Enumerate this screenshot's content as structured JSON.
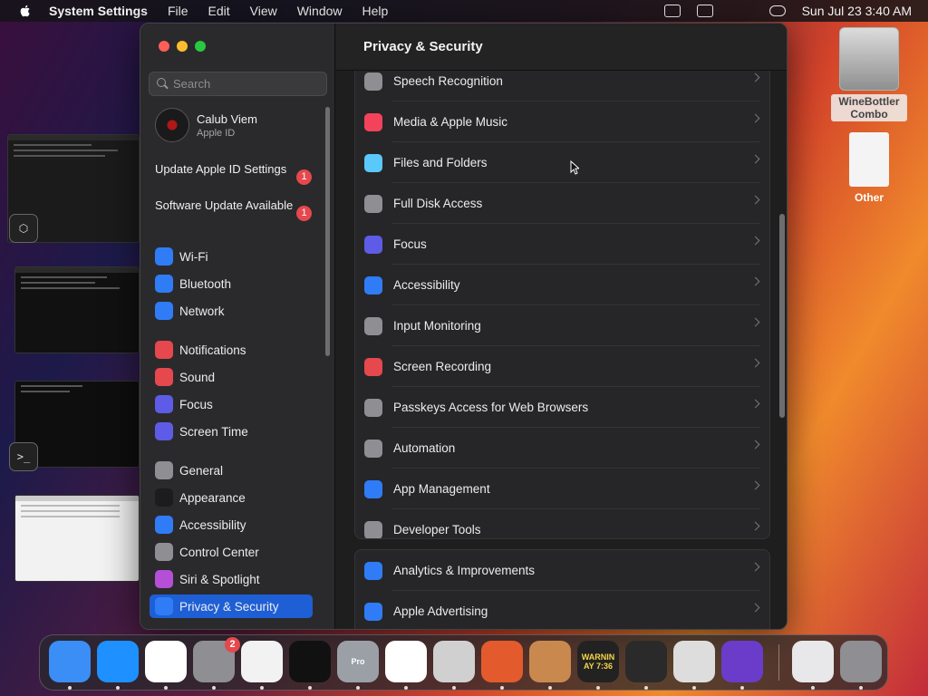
{
  "menubar": {
    "app_name": "System Settings",
    "menus": [
      "File",
      "Edit",
      "View",
      "Window",
      "Help"
    ],
    "datetime": "Sun Jul 23  3:40 AM"
  },
  "desktop": {
    "items": [
      {
        "label": "WineBottler Combo",
        "icon": "disk-image-icon"
      },
      {
        "label": "Other",
        "icon": "log-document-icon"
      }
    ]
  },
  "window": {
    "sidebar": {
      "search_placeholder": "Search",
      "profile": {
        "name": "Calub Viem",
        "subtitle": "Apple ID"
      },
      "alerts": [
        {
          "label": "Update Apple ID Settings",
          "badge": "1"
        },
        {
          "label": "Software Update Available",
          "badge": "1"
        }
      ],
      "items": [
        {
          "label": "Wi-Fi",
          "icon": "wifi-icon",
          "color": "#2f7cf6"
        },
        {
          "label": "Bluetooth",
          "icon": "bluetooth-icon",
          "color": "#2f7cf6"
        },
        {
          "label": "Network",
          "icon": "globe-icon",
          "color": "#2f7cf6"
        },
        {
          "label": "Notifications",
          "icon": "bell-icon",
          "color": "#e5484d"
        },
        {
          "label": "Sound",
          "icon": "speaker-icon",
          "color": "#e5484d"
        },
        {
          "label": "Focus",
          "icon": "moon-icon",
          "color": "#5e5ce6"
        },
        {
          "label": "Screen Time",
          "icon": "hourglass-icon",
          "color": "#5e5ce6"
        },
        {
          "label": "General",
          "icon": "gear-icon",
          "color": "#8e8e93"
        },
        {
          "label": "Appearance",
          "icon": "appearance-icon",
          "color": "#1c1c1e"
        },
        {
          "label": "Accessibility",
          "icon": "accessibility-icon",
          "color": "#2f7cf6"
        },
        {
          "label": "Control Center",
          "icon": "control-center-icon",
          "color": "#8e8e93"
        },
        {
          "label": "Siri & Spotlight",
          "icon": "siri-icon",
          "color": "#b44fd6"
        },
        {
          "label": "Privacy & Security",
          "icon": "hand-icon",
          "color": "#2f7cf6",
          "active": true
        }
      ]
    },
    "content": {
      "title": "Privacy & Security",
      "group1": [
        {
          "label": "Speech Recognition",
          "icon": "waveform-icon",
          "color": "#8e8e93"
        },
        {
          "label": "Media & Apple Music",
          "icon": "music-note-icon",
          "color": "#f2435a"
        },
        {
          "label": "Files and Folders",
          "icon": "folder-icon",
          "color": "#5ac8fa"
        },
        {
          "label": "Full Disk Access",
          "icon": "disk-icon",
          "color": "#8e8e93"
        },
        {
          "label": "Focus",
          "icon": "moon-icon",
          "color": "#5e5ce6"
        },
        {
          "label": "Accessibility",
          "icon": "accessibility-icon",
          "color": "#2f7cf6"
        },
        {
          "label": "Input Monitoring",
          "icon": "keyboard-icon",
          "color": "#8e8e93"
        },
        {
          "label": "Screen Recording",
          "icon": "record-icon",
          "color": "#e5484d"
        },
        {
          "label": "Passkeys Access for Web Browsers",
          "icon": "person-key-icon",
          "color": "#8e8e93"
        },
        {
          "label": "Automation",
          "icon": "gears-icon",
          "color": "#8e8e93"
        },
        {
          "label": "App Management",
          "icon": "app-store-icon",
          "color": "#2f7cf6"
        },
        {
          "label": "Developer Tools",
          "icon": "hammer-icon",
          "color": "#8e8e93"
        }
      ],
      "group2": [
        {
          "label": "Analytics & Improvements",
          "icon": "bar-chart-icon",
          "color": "#2f7cf6"
        },
        {
          "label": "Apple Advertising",
          "icon": "megaphone-icon",
          "color": "#2f7cf6"
        }
      ]
    }
  },
  "dock": {
    "items": [
      {
        "name": "finder-icon",
        "color": "#3a8ef6"
      },
      {
        "name": "safari-icon",
        "color": "#1e90ff"
      },
      {
        "name": "chrome-icon",
        "color": "#ffffff"
      },
      {
        "name": "system-settings-icon",
        "color": "#8e8e93",
        "badge": "2"
      },
      {
        "name": "textedit-icon",
        "color": "#f2f2f2"
      },
      {
        "name": "terminal-icon",
        "color": "#111111"
      },
      {
        "name": "macos-installer-icon",
        "color": "#9aa0a6",
        "text": "Pro"
      },
      {
        "name": "vscode-icon",
        "color": "#ffffff"
      },
      {
        "name": "launchpad-icon",
        "color": "#d0d0d0"
      },
      {
        "name": "remote-desktop-icon",
        "color": "#e35b2c"
      },
      {
        "name": "package-icon",
        "color": "#c9894e"
      },
      {
        "name": "console-icon",
        "color": "#222222",
        "text": "WARNIN AY 7:36"
      },
      {
        "name": "wine-hex-icon",
        "color": "#2a2a2a"
      },
      {
        "name": "gear-settings-icon",
        "color": "#dddddd"
      },
      {
        "name": "firefox-icon",
        "color": "#6a3cc9"
      },
      {
        "name": "downloads-icon",
        "color": "#e8e8ea"
      },
      {
        "name": "trash-icon",
        "color": "#8e8e93"
      }
    ]
  }
}
